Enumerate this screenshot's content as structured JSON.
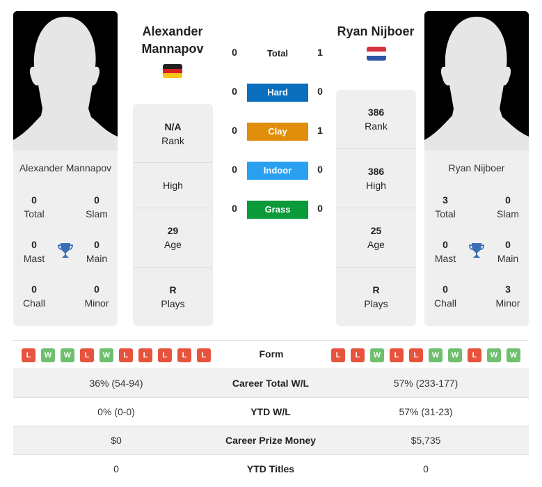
{
  "player1": {
    "name": "Alexander Mannapov",
    "name_line1": "Alexander",
    "name_line2": "Mannapov",
    "card_name": "Alexander Mannapov",
    "flag": "germany-flag",
    "titles": {
      "total": {
        "value": "0",
        "label": "Total"
      },
      "slam": {
        "value": "0",
        "label": "Slam"
      },
      "mast": {
        "value": "0",
        "label": "Mast"
      },
      "main": {
        "value": "0",
        "label": "Main"
      },
      "chall": {
        "value": "0",
        "label": "Chall"
      },
      "minor": {
        "value": "0",
        "label": "Minor"
      }
    },
    "rank": {
      "value": "N/A",
      "label": "Rank"
    },
    "high": {
      "value": "",
      "label": "High"
    },
    "age": {
      "value": "29",
      "label": "Age"
    },
    "plays": {
      "value": "R",
      "label": "Plays"
    },
    "form": [
      "L",
      "W",
      "W",
      "L",
      "W",
      "L",
      "L",
      "L",
      "L",
      "L"
    ]
  },
  "player2": {
    "name": "Ryan Nijboer",
    "card_name": "Ryan Nijboer",
    "flag": "netherlands-flag",
    "titles": {
      "total": {
        "value": "3",
        "label": "Total"
      },
      "slam": {
        "value": "0",
        "label": "Slam"
      },
      "mast": {
        "value": "0",
        "label": "Mast"
      },
      "main": {
        "value": "0",
        "label": "Main"
      },
      "chall": {
        "value": "0",
        "label": "Chall"
      },
      "minor": {
        "value": "3",
        "label": "Minor"
      }
    },
    "rank": {
      "value": "386",
      "label": "Rank"
    },
    "high": {
      "value": "386",
      "label": "High"
    },
    "age": {
      "value": "25",
      "label": "Age"
    },
    "plays": {
      "value": "R",
      "label": "Plays"
    },
    "form": [
      "L",
      "L",
      "W",
      "L",
      "L",
      "W",
      "W",
      "L",
      "W",
      "W"
    ]
  },
  "h2h": {
    "total": {
      "label": "Total",
      "p1": "0",
      "p2": "1"
    },
    "surfaces": [
      {
        "label": "Hard",
        "p1": "0",
        "p2": "0",
        "color": "#0a6ebd"
      },
      {
        "label": "Clay",
        "p1": "0",
        "p2": "1",
        "color": "#e08e0b"
      },
      {
        "label": "Indoor",
        "p1": "0",
        "p2": "0",
        "color": "#2aa0f0"
      },
      {
        "label": "Grass",
        "p1": "0",
        "p2": "0",
        "color": "#0a9a3a"
      }
    ]
  },
  "comparison": {
    "form_label": "Form",
    "rows": [
      {
        "label": "Career Total W/L",
        "p1": "36% (54-94)",
        "p2": "57% (233-177)"
      },
      {
        "label": "YTD W/L",
        "p1": "0% (0-0)",
        "p2": "57% (31-23)"
      },
      {
        "label": "Career Prize Money",
        "p1": "$0",
        "p2": "$5,735"
      },
      {
        "label": "YTD Titles",
        "p1": "0",
        "p2": "0"
      }
    ]
  },
  "colors": {
    "win": "#6ebf6e",
    "loss": "#e8533d",
    "trophy": "#3a6fb5"
  }
}
